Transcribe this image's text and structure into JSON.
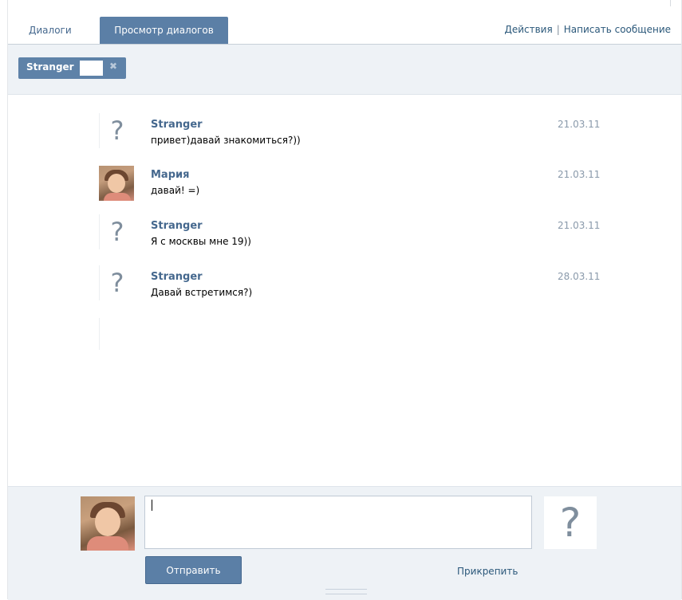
{
  "tabs": {
    "dialogs": "Диалоги",
    "view_dialogs": "Просмотр диалогов"
  },
  "actions": {
    "actions_label": "Действия",
    "separator": "|",
    "write_message": "Написать сообщение"
  },
  "filter": {
    "chip_label": "Stranger",
    "remove_icon": "close-icon",
    "remove_glyph": "✖"
  },
  "messages": [
    {
      "author": "Stranger",
      "text": "привет)давай знакомиться?))",
      "date": "21.03.11",
      "avatar": "question-mark-icon"
    },
    {
      "author": "Мария",
      "text": "давай! =)",
      "date": "21.03.11",
      "avatar": "user-photo"
    },
    {
      "author": "Stranger",
      "text": "Я с москвы мне 19))",
      "date": "21.03.11",
      "avatar": "question-mark-icon"
    },
    {
      "author": "Stranger",
      "text": "Давай встретимся?)",
      "date": "28.03.11",
      "avatar": "question-mark-icon"
    }
  ],
  "avatar_glyph": "?",
  "composer": {
    "input_value": "",
    "send_label": "Отправить",
    "attach_label": "Прикрепить"
  },
  "colors": {
    "accent": "#5b7fa6",
    "link": "#45688e",
    "date": "#8a9aab",
    "panel_bg": "#eef2f6"
  }
}
